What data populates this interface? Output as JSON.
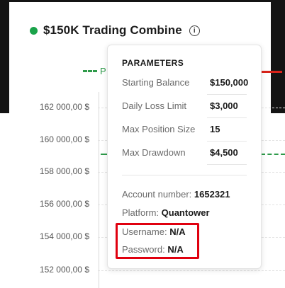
{
  "header": {
    "title": "$150K Trading Combine",
    "status_color": "#1aa34a"
  },
  "legend": {
    "partial_label": "P"
  },
  "chart": {
    "y_ticks": [
      "162 000,00 $",
      "160 000,00 $",
      "158 000,00 $",
      "156 000,00 $",
      "154 000,00 $",
      "152 000,00 $"
    ]
  },
  "tooltip": {
    "heading": "PARAMETERS",
    "params": [
      {
        "label": "Starting Balance",
        "value": "$150,000"
      },
      {
        "label": "Daily Loss Limit",
        "value": "$3,000"
      },
      {
        "label": "Max Position Size",
        "value": "15"
      },
      {
        "label": "Max Drawdown",
        "value": "$4,500"
      }
    ],
    "account_number_label": "Account number:",
    "account_number": "1652321",
    "platform_label": "Platform:",
    "platform": "Quantower",
    "username_label": "Username:",
    "username": "N/A",
    "password_label": "Password:",
    "password": "N/A"
  },
  "colors": {
    "profit_target": "#2e9a4a",
    "loss_limit": "#d9231a",
    "highlight": "#e0000f"
  },
  "icons": {
    "info": "info-circle-icon"
  }
}
